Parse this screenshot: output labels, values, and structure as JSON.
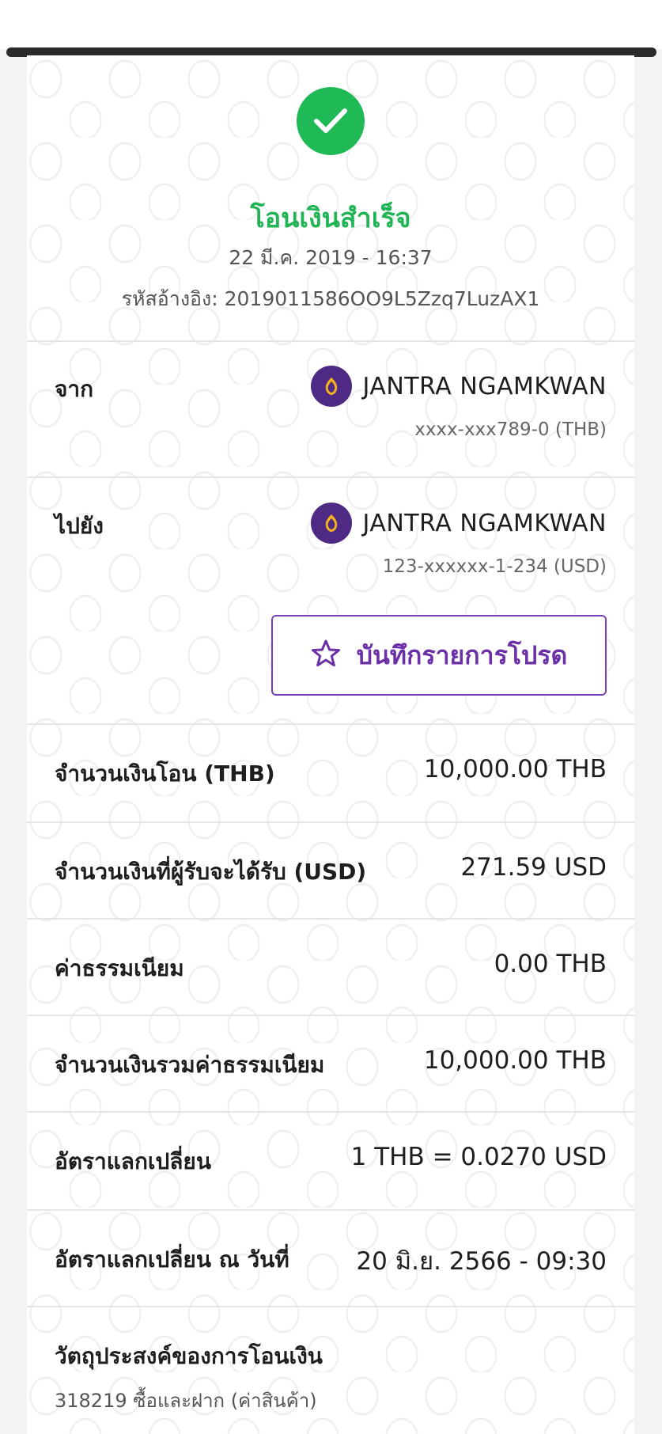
{
  "header": {
    "status": "โอนเงินสำเร็จ",
    "datetime": "22 มี.ค. 2019 - 16:37",
    "reference": "รหัสอ้างอิง: 2019011586OO9L5Zzq7LuzAX1"
  },
  "from": {
    "label": "จาก",
    "name": "JANTRA NGAMKWAN",
    "account": "xxxx-xxx789-0 (THB)",
    "icon": "bank-logo-icon"
  },
  "to": {
    "label": "ไปยัง",
    "name": "JANTRA NGAMKWAN",
    "account": "123-xxxxxx-1-234 (USD)",
    "icon": "bank-logo-icon"
  },
  "favorite_button": {
    "label": "บันทึกรายการโปรด",
    "icon": "star-icon"
  },
  "details": [
    {
      "label": "จำนวนเงินโอน (THB)",
      "value": "10,000.00 THB"
    },
    {
      "label": "จำนวนเงินที่ผู้รับจะได้รับ (USD)",
      "value": "271.59 USD"
    },
    {
      "label": "ค่าธรรมเนียม",
      "value": "0.00 THB"
    },
    {
      "label": "จำนวนเงินรวมค่าธรรมเนียม",
      "value": "10,000.00 THB"
    },
    {
      "label": "อัตราแลกเปลี่ยน",
      "value": "1 THB = 0.0270 USD"
    },
    {
      "label": "อัตราแลกเปลี่ยน ณ วันที่",
      "value": "20 มิ.ย. 2566 - 09:30"
    }
  ],
  "purpose": {
    "label": "วัตถุประสงค์ของการโอนเงิน",
    "value": "318219 ซื้อและฝาก (ค่าสินค้า)"
  },
  "colors": {
    "success": "#1fb955",
    "brand_purple": "#4e2a84",
    "brand_gold": "#f5b320",
    "accent_purple": "#6b2fa8"
  }
}
